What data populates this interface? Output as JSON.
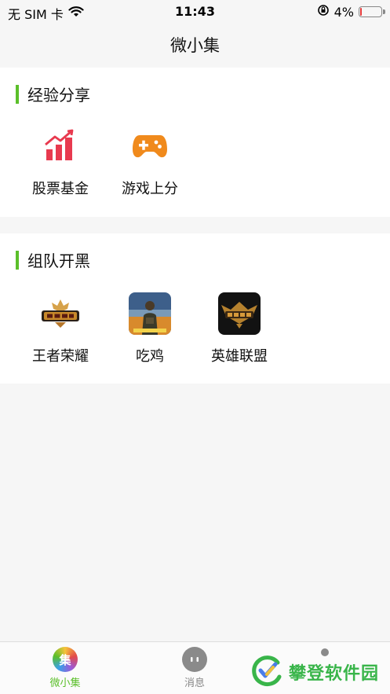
{
  "status": {
    "carrier": "无 SIM 卡",
    "time": "11:43",
    "battery": "4%",
    "battery_level": 0.04
  },
  "nav": {
    "title": "微小集"
  },
  "sections": [
    {
      "title": "经验分享",
      "items": [
        {
          "label": "股票基金",
          "icon": "stock-chart-icon"
        },
        {
          "label": "游戏上分",
          "icon": "gamepad-icon"
        }
      ]
    },
    {
      "title": "组队开黑",
      "items": [
        {
          "label": "王者荣耀",
          "icon": "honor-of-kings-icon"
        },
        {
          "label": "吃鸡",
          "icon": "pubg-icon"
        },
        {
          "label": "英雄联盟",
          "icon": "league-of-legends-icon"
        }
      ]
    }
  ],
  "tabs": [
    {
      "label": "微小集",
      "icon_text": "集",
      "active": true
    },
    {
      "label": "消息",
      "active": false
    }
  ],
  "watermark": {
    "text": "攀登软件园"
  },
  "colors": {
    "accent": "#5bbf2a",
    "stock": "#e83a4f",
    "game": "#f08a1c",
    "tab_active": "#5bbf2a",
    "tab_inactive": "#888888"
  }
}
